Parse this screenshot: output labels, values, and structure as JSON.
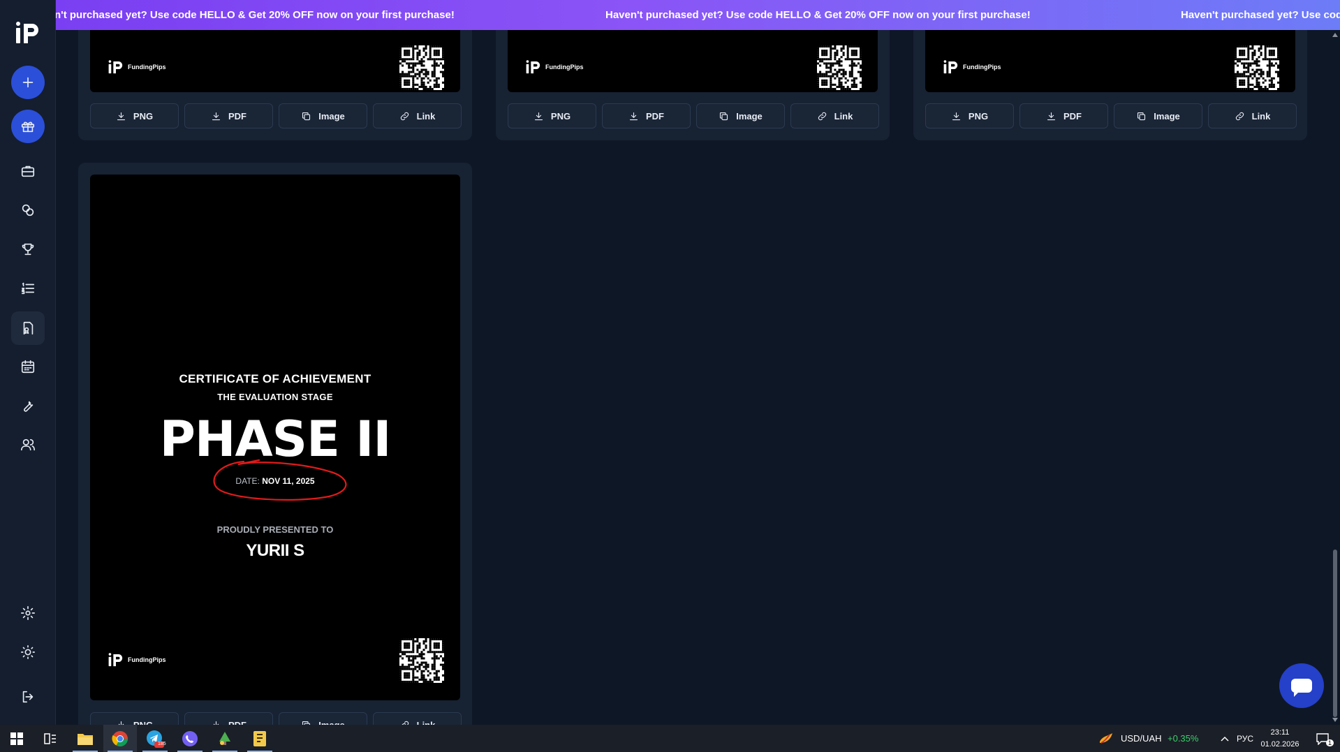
{
  "promo": {
    "text_partial": "n't purchased yet? Use code HELLO & Get 20% OFF now on your first purchase!",
    "text_full": "Haven't purchased yet? Use code HELLO & Get 20% OFF now on your first purchase!",
    "text_trailing": "Haven't purchased yet? Use code"
  },
  "brand": {
    "name": "FundingPips"
  },
  "actions": {
    "png": "PNG",
    "pdf": "PDF",
    "image": "Image",
    "link": "Link"
  },
  "certificate": {
    "title": "CERTIFICATE OF ACHIEVEMENT",
    "subtitle": "THE EVALUATION STAGE",
    "phase": "PHASE II",
    "date_label": "DATE:",
    "date_value": "NOV 11, 2025",
    "presented_label": "PROUDLY PRESENTED TO",
    "recipient": "YURII S"
  },
  "taskbar": {
    "telegram_badge": "185",
    "currency_pair": "USD/UAH",
    "currency_change": "+0.35%",
    "language": "РУС",
    "time": "23:11",
    "date": "01.02.2026",
    "notifications": "1"
  },
  "colors": {
    "accent": "#2b4fd9",
    "promo_start": "#7a3ff2",
    "promo_end": "#6d7cf7",
    "background": "#0e1726",
    "positive": "#3ad06b"
  }
}
